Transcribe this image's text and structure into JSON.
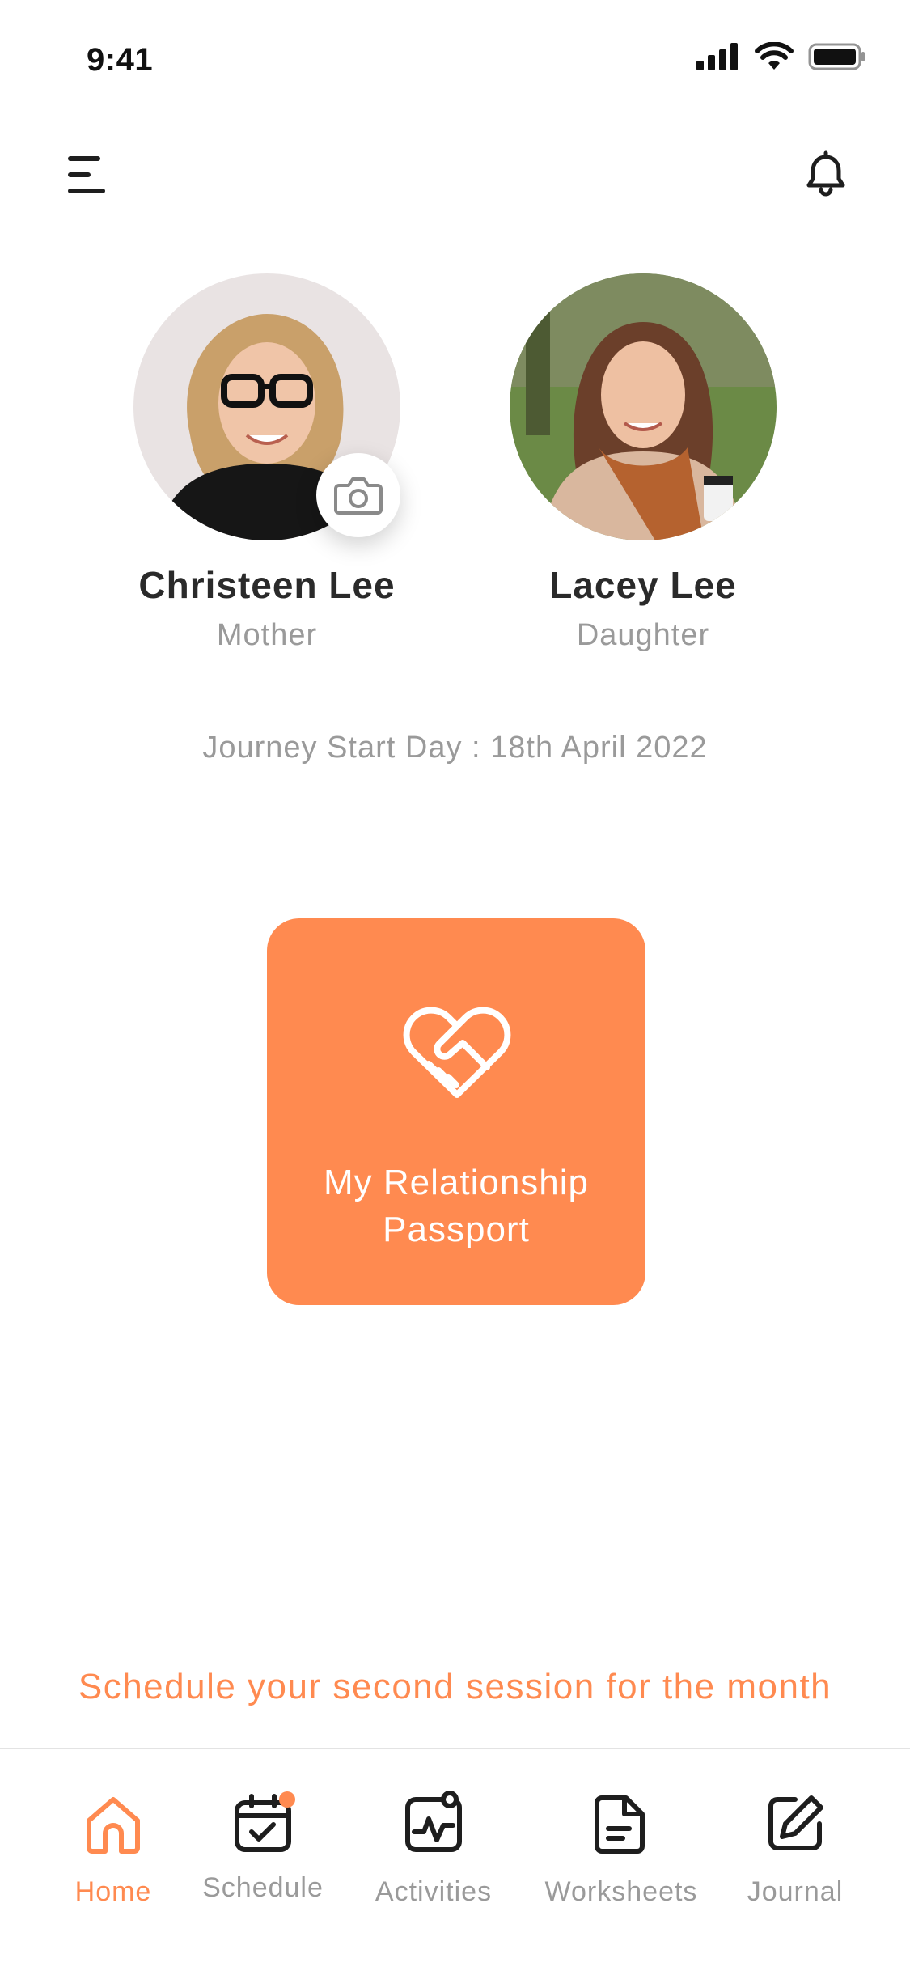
{
  "status_bar": {
    "time": "9:41"
  },
  "profiles": [
    {
      "name": "Christeen Lee",
      "role": "Mother"
    },
    {
      "name": "Lacey Lee",
      "role": "Daughter"
    }
  ],
  "journey": {
    "text": "Journey Start Day : 18th April 2022"
  },
  "passport": {
    "label": "My Relationship\nPassport"
  },
  "reminder": {
    "text": "Schedule your second session for the month"
  },
  "nav": {
    "items": [
      {
        "label": "Home",
        "icon": "home-icon"
      },
      {
        "label": "Schedule",
        "icon": "calendar-check-icon"
      },
      {
        "label": "Activities",
        "icon": "activity-chart-icon"
      },
      {
        "label": "Worksheets",
        "icon": "document-icon"
      },
      {
        "label": "Journal",
        "icon": "edit-note-icon"
      }
    ]
  },
  "colors": {
    "accent": "#ff8a50",
    "muted": "#9a9a9a",
    "text": "#2a2a2a"
  }
}
